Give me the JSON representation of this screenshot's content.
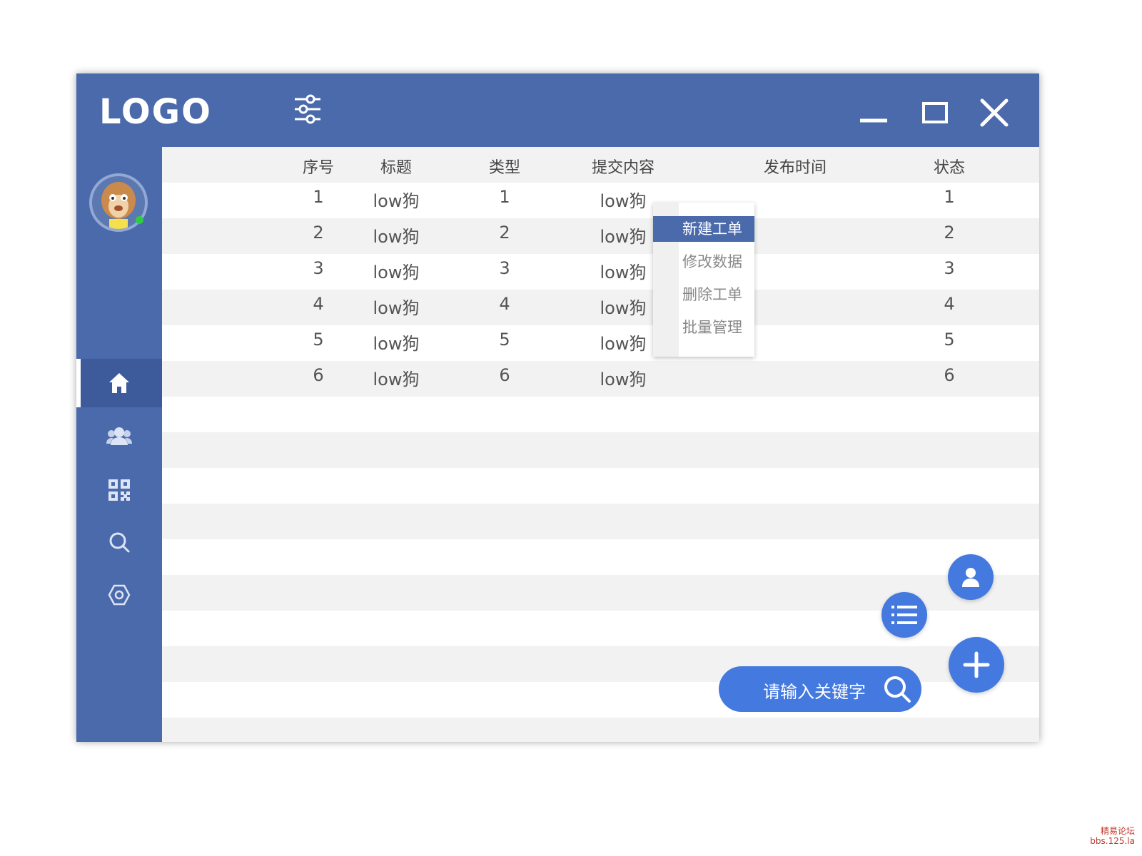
{
  "app": {
    "logo": "LOGO"
  },
  "table": {
    "columns": [
      "序号",
      "标题",
      "类型",
      "提交内容",
      "发布时间",
      "状态"
    ],
    "rows": [
      [
        "1",
        "low狗",
        "1",
        "low狗",
        "",
        "1"
      ],
      [
        "2",
        "low狗",
        "2",
        "low狗",
        "",
        "2"
      ],
      [
        "3",
        "low狗",
        "3",
        "low狗",
        "",
        "3"
      ],
      [
        "4",
        "low狗",
        "4",
        "low狗",
        "",
        "4"
      ],
      [
        "5",
        "low狗",
        "5",
        "low狗",
        "",
        "5"
      ],
      [
        "6",
        "low狗",
        "6",
        "low狗",
        "",
        "6"
      ]
    ]
  },
  "context_menu": {
    "items": [
      "新建工单",
      "修改数据",
      "删除工单",
      "批量管理"
    ],
    "selected_index": 0
  },
  "search": {
    "placeholder": "请输入关键字"
  },
  "sidebar": {
    "items": [
      "home-icon",
      "users-icon",
      "qrcode-icon",
      "search-icon",
      "settings-icon"
    ],
    "active_index": 0
  },
  "colors": {
    "titlebar": "#4a6aab",
    "sidebar_active": "#3d5a9b",
    "accent": "#4479e0",
    "row_stripe": "#f2f2f2"
  },
  "watermark": {
    "line1": "精易论坛",
    "line2": "bbs.125.la"
  }
}
